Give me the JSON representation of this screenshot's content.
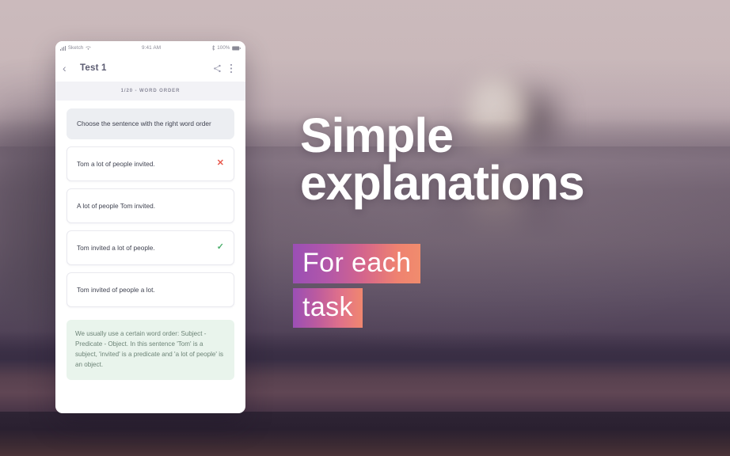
{
  "background": {
    "description": "blurred-photo-backdrop",
    "tones": [
      "#cbbabc",
      "#7d6d7c",
      "#5d4f63",
      "#3a2f45",
      "#2e2434"
    ]
  },
  "phone": {
    "status_bar": {
      "carrier": "Sketch",
      "signal_icon": "signal-bars-icon",
      "wifi_icon": "wifi-icon",
      "time": "9:41 AM",
      "bluetooth_icon": "bluetooth-icon",
      "battery_percent": "100%",
      "battery_icon": "battery-full-icon"
    },
    "nav_bar": {
      "back_icon": "chevron-left-icon",
      "title": "Test 1",
      "share_icon": "share-icon",
      "overflow_icon": "more-vertical-icon"
    },
    "progress_label": "1/20 - WORD ORDER",
    "question": "Choose the sentence with the right word order",
    "options": [
      {
        "text": "Tom a lot of people invited.",
        "mark": "✕",
        "mark_state": "wrong"
      },
      {
        "text": "A lot of people Tom invited.",
        "mark": "",
        "mark_state": "none"
      },
      {
        "text": "Tom invited a lot of people.",
        "mark": "✓",
        "mark_state": "right"
      },
      {
        "text": "Tom invited of people a lot.",
        "mark": "",
        "mark_state": "none"
      }
    ],
    "explanation": "We usually use a certain word order: Subject - Predicate - Object. In this sentence 'Tom' is a subject, 'invited' is a predicate and 'a lot of people' is an object."
  },
  "marketing": {
    "headline_line1": "Simple",
    "headline_line2": "explanations",
    "highlight_line1": "For each",
    "highlight_line2": "task",
    "highlight_gradient_from": "#9a4fb5",
    "highlight_gradient_to": "#f08c6d",
    "headline_color": "#ffffff"
  }
}
